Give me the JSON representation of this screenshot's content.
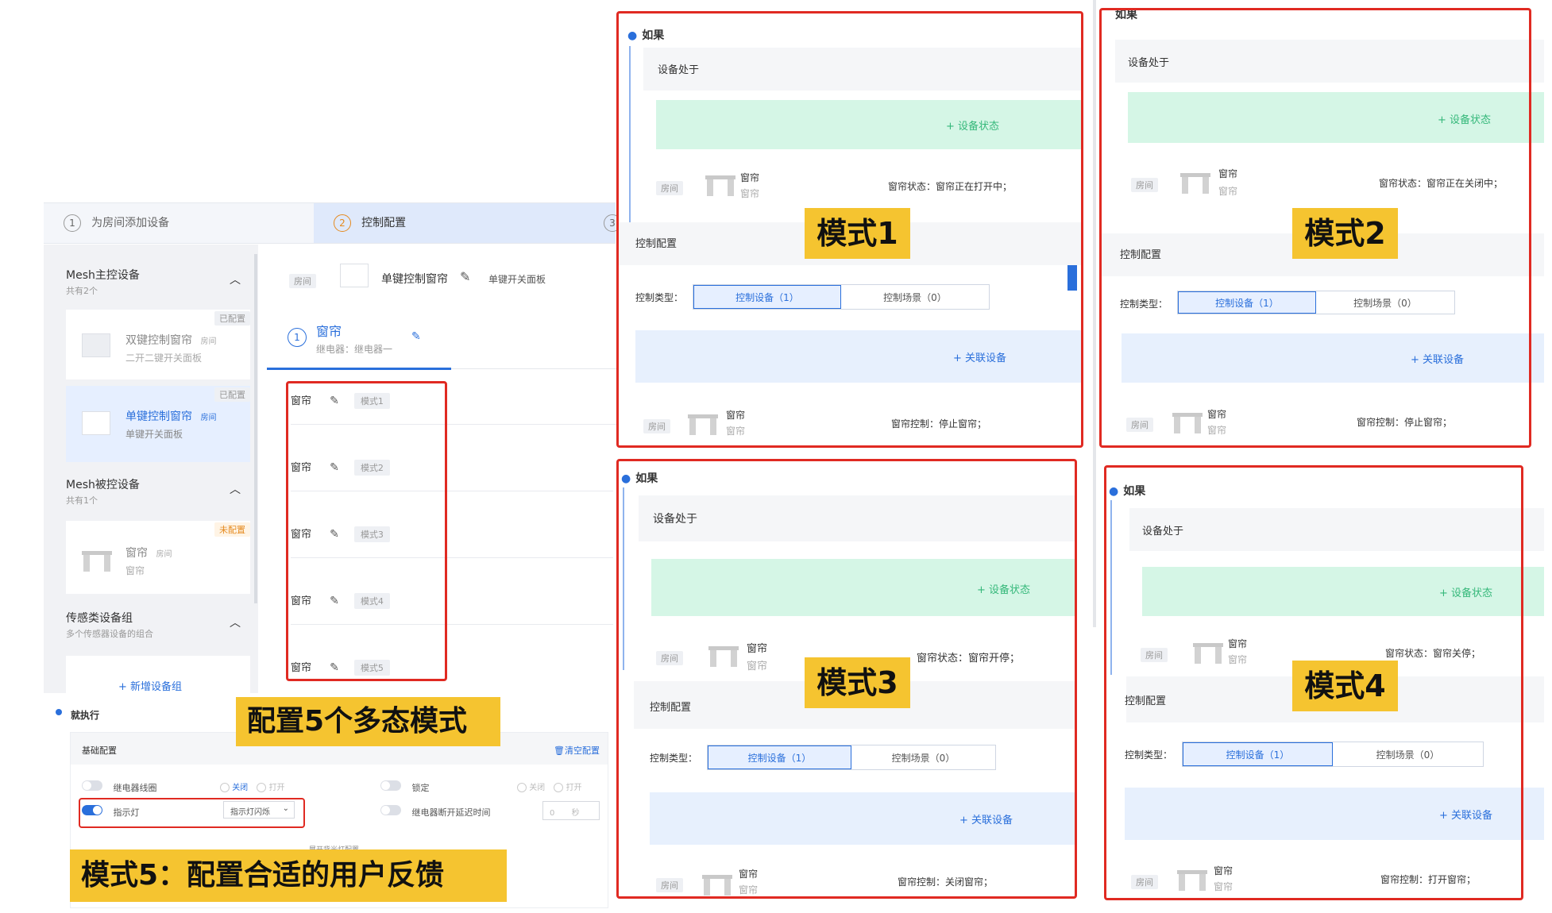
{
  "steps": [
    {
      "num": "1",
      "label": "为房间添加设备"
    },
    {
      "num": "2",
      "label": "控制配置"
    },
    {
      "num": "3"
    }
  ],
  "sidebar": {
    "group1": {
      "title": "Mesh主控设备",
      "sub": "共有2个"
    },
    "card1": {
      "status": "已配置",
      "name": "双键控制窗帘",
      "room": "房间",
      "desc": "二开二键开关面板"
    },
    "card2": {
      "status": "已配置",
      "name": "单键控制窗帘",
      "room": "房间",
      "desc": "单键开关面板"
    },
    "group2": {
      "title": "Mesh被控设备",
      "sub": "共有1个"
    },
    "card3": {
      "status": "未配置",
      "name": "窗帘",
      "room": "房间",
      "desc": "窗帘"
    },
    "group3": {
      "title": "传感类设备组",
      "sub": "多个传感器设备的组合"
    },
    "add_group": "+ 新增设备组"
  },
  "main": {
    "room_tag": "房间",
    "device_name": "单键控制窗帘",
    "device_type": "单键开关面板",
    "sub_num": "1",
    "sub_name": "窗帘",
    "sub_desc": "继电器：继电器一",
    "modes": [
      {
        "name": "窗帘",
        "tag": "模式1"
      },
      {
        "name": "窗帘",
        "tag": "模式2"
      },
      {
        "name": "窗帘",
        "tag": "模式3"
      },
      {
        "name": "窗帘",
        "tag": "模式4"
      },
      {
        "name": "窗帘",
        "tag": "模式5"
      }
    ]
  },
  "execute": {
    "title": "就执行",
    "basic": "基础配置",
    "clear": "清空配置",
    "relay_coil": "继电器线圈",
    "off": "关闭",
    "on": "打开",
    "lock": "锁定",
    "indicator": "指示灯",
    "indicator_value": "指示灯闪烁",
    "relay_delay": "继电器断开延迟时间",
    "delay_value": "0",
    "delay_unit": "秒",
    "expand": "展开背光灯配置"
  },
  "annotations": {
    "config5": "配置5个多态模式",
    "mode5": "模式5：配置合适的用户反馈",
    "mode1": "模式1",
    "mode2": "模式2",
    "mode3": "模式3",
    "mode4": "模式4"
  },
  "panels": {
    "if_label": "如果",
    "device_in": "设备处于",
    "add_state": "+ 设备状态",
    "room": "房间",
    "curtain": "窗帘",
    "control_config": "控制配置",
    "control_type": "控制类型：",
    "control_device": "控制设备（1）",
    "control_scene": "控制场景（0）",
    "link_device": "+ 关联设备",
    "p1": {
      "state": "窗帘状态：窗帘正在打开中；",
      "control": "窗帘控制：停止窗帘；"
    },
    "p2": {
      "state": "窗帘状态：窗帘正在关闭中；",
      "control": "窗帘控制：停止窗帘；"
    },
    "p3": {
      "state": "窗帘状态：窗帘开停；",
      "control": "窗帘控制：关闭窗帘；"
    },
    "p4": {
      "state": "窗帘状态：窗帘关停；",
      "control": "窗帘控制：打开窗帘；"
    }
  }
}
